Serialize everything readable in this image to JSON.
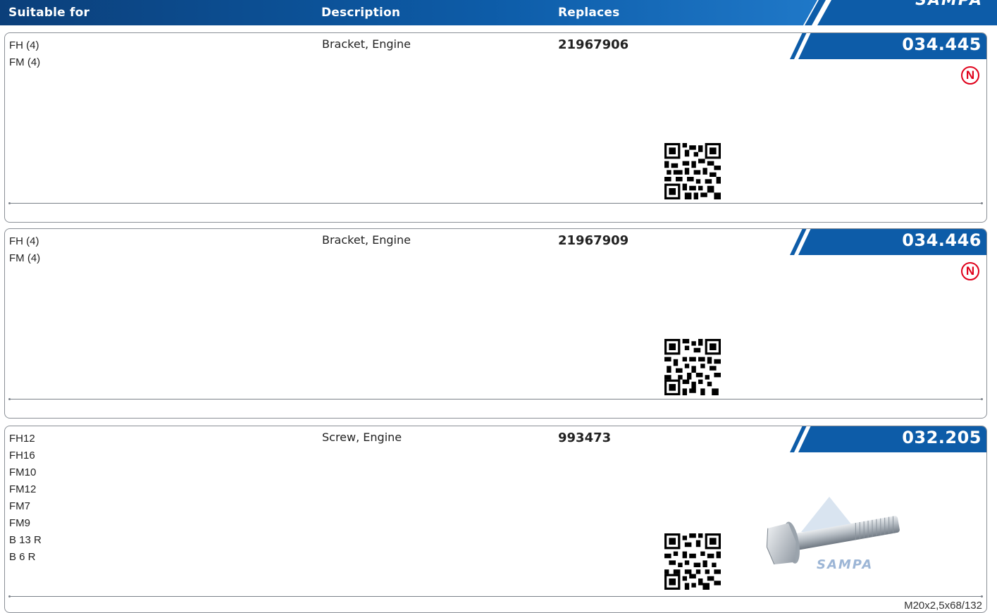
{
  "header": {
    "col_suitable": "Suitable for",
    "col_description": "Description",
    "col_replaces": "Replaces",
    "brand": "SAMPA"
  },
  "colors": {
    "brand_blue": "#0d5ca8",
    "badge_red": "#e0001a"
  },
  "products": [
    {
      "applications": [
        "FH (4)",
        "FM (4)"
      ],
      "description": "Bracket, Engine",
      "replaces": "21967906",
      "part_number": "034.445",
      "badge": "N"
    },
    {
      "applications": [
        "FH (4)",
        "FM (4)"
      ],
      "description": "Bracket, Engine",
      "replaces": "21967909",
      "part_number": "034.446",
      "badge": "N"
    },
    {
      "applications": [
        "FH12",
        "FH16",
        "FM10",
        "FM12",
        "FM7",
        "FM9",
        "B 13 R",
        "B 6 R"
      ],
      "description": "Screw, Engine",
      "replaces": "993473",
      "part_number": "032.205",
      "image_watermark": "SAMPA",
      "dimensions": "M20x2,5x68/132"
    }
  ]
}
